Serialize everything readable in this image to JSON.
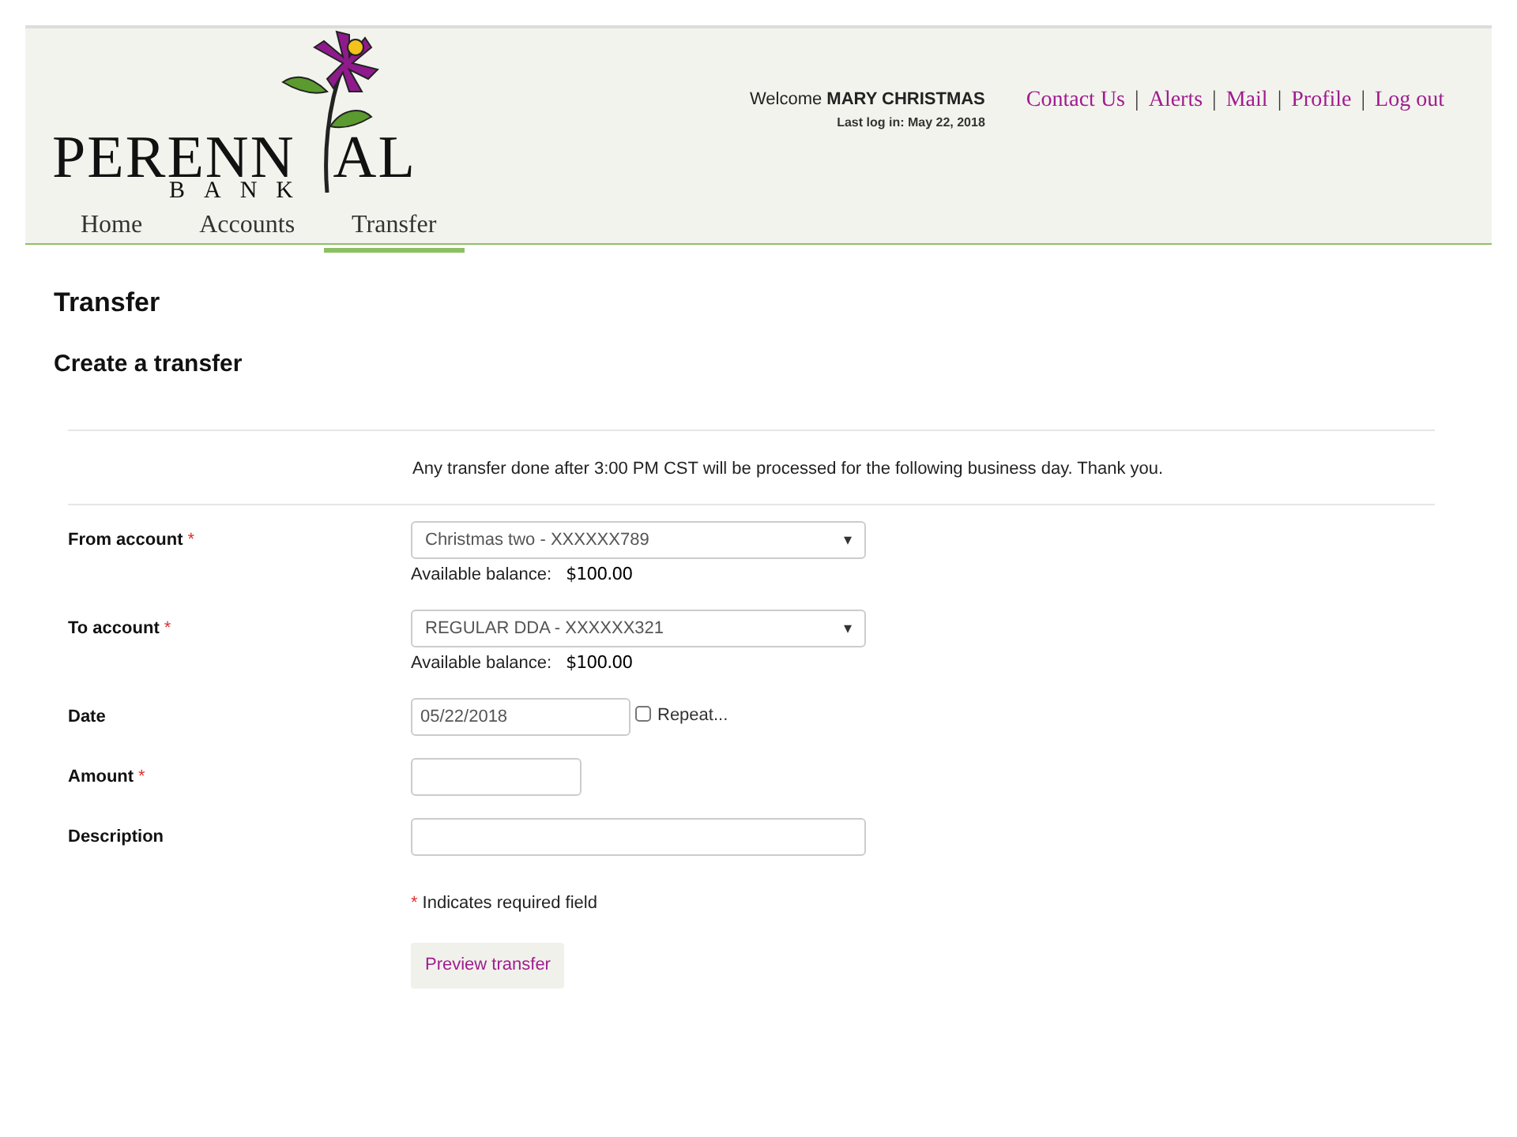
{
  "header": {
    "logo": {
      "left": "PERENN",
      "right": "AL",
      "sub": "BANK"
    },
    "welcome": {
      "prefix": "Welcome",
      "name": "MARY CHRISTMAS",
      "last_login": "Last log in: May 22, 2018"
    },
    "links": [
      {
        "label": "Contact Us"
      },
      {
        "label": "Alerts"
      },
      {
        "label": "Mail"
      },
      {
        "label": "Profile"
      },
      {
        "label": "Log out"
      }
    ],
    "separator": "|",
    "nav": [
      {
        "label": "Home",
        "selected": false
      },
      {
        "label": "Accounts",
        "selected": false
      },
      {
        "label": "Transfer",
        "selected": true
      }
    ]
  },
  "page_title": "Transfer",
  "section_title": "Create a transfer",
  "notice": "Any transfer done after 3:00 PM CST will be processed for the following business day. Thank you.",
  "fields": [
    {
      "kind": "select",
      "label": "From account",
      "required_mark": "*",
      "value": "Christmas two - XXXXXX789",
      "caret": "▾",
      "balance_label": "Available balance:",
      "balance": "$100.00"
    },
    {
      "kind": "select",
      "label": "To account",
      "required_mark": "*",
      "value": "REGULAR DDA - XXXXXX321",
      "caret": "▾",
      "balance_label": "Available balance:",
      "balance": "$100.00"
    },
    {
      "kind": "date",
      "label": "Date",
      "value": "05/22/2018",
      "repeat": {
        "label": "Repeat...",
        "checked": false
      }
    },
    {
      "kind": "short",
      "label": "Amount",
      "required_mark": "*"
    },
    {
      "kind": "long",
      "label": "Description"
    }
  ],
  "required_note": {
    "mark": "*",
    "text": "Indicates required field"
  },
  "button": "Preview transfer"
}
